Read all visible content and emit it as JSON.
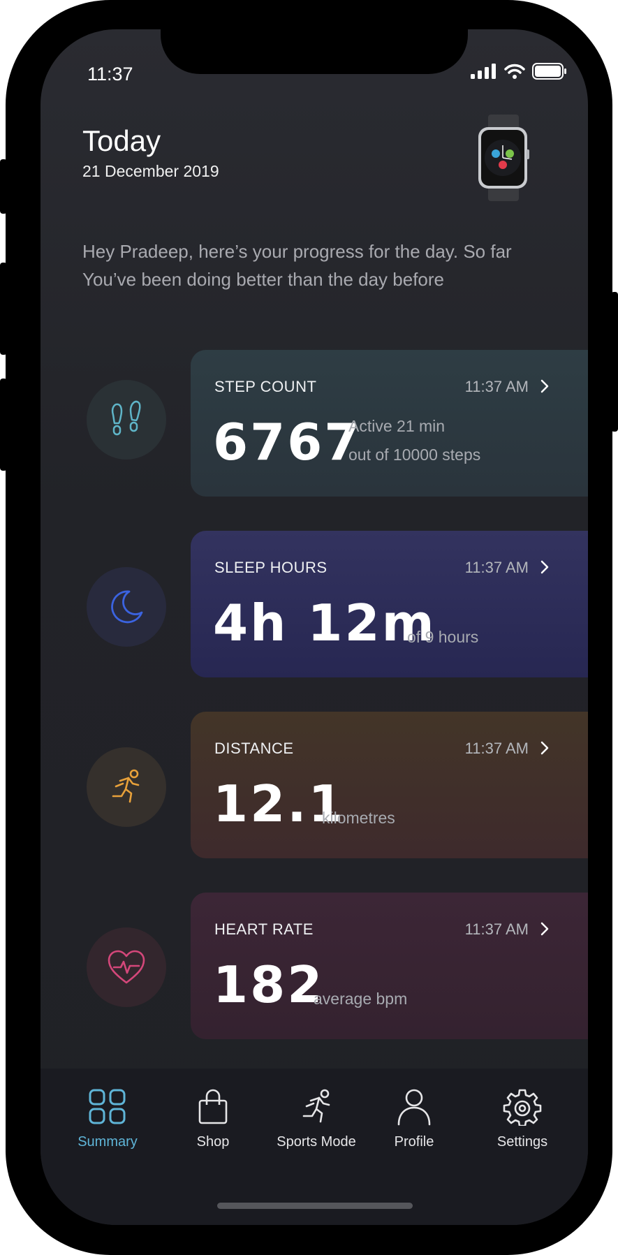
{
  "status_bar": {
    "time": "11:37"
  },
  "header": {
    "title": "Today",
    "date": "21 December 2019",
    "intro": "Hey Pradeep, here’s your progress for the day. So far You’ve been doing better than the day before"
  },
  "metrics": [
    {
      "title": "STEP COUNT",
      "time": "11:37 AM",
      "value": "6767",
      "sub1": "Active 21 min",
      "sub2": "out of 10000 steps",
      "icon": "footprints-icon",
      "accent": "#5fb5c8"
    },
    {
      "title": "SLEEP HOURS",
      "time": "11:37 AM",
      "value": "4h 12m",
      "sub1": "of 9 hours",
      "icon": "moon-icon",
      "accent": "#3b63e0"
    },
    {
      "title": "DISTANCE",
      "time": "11:37 AM",
      "value": "12.1",
      "sub1": "kilometres",
      "icon": "runner-icon",
      "accent": "#e8a13a"
    },
    {
      "title": "HEART RATE",
      "time": "11:37 AM",
      "value": "182",
      "sub1": "average bpm",
      "icon": "heart-pulse-icon",
      "accent": "#d4477a"
    }
  ],
  "tabs": [
    {
      "label": "Summary",
      "icon": "grid-icon",
      "active": true
    },
    {
      "label": "Shop",
      "icon": "bag-icon"
    },
    {
      "label": "Sports Mode",
      "icon": "runner-icon"
    },
    {
      "label": "Profile",
      "icon": "person-icon"
    },
    {
      "label": "Settings",
      "icon": "gear-icon"
    }
  ],
  "colors": {
    "active_tab": "#5fb5d8",
    "step_card": "#2b3a42",
    "sleep_card": "#2a2a58",
    "distance_card": "#3d2f2a",
    "heart_card": "#3a2533"
  }
}
